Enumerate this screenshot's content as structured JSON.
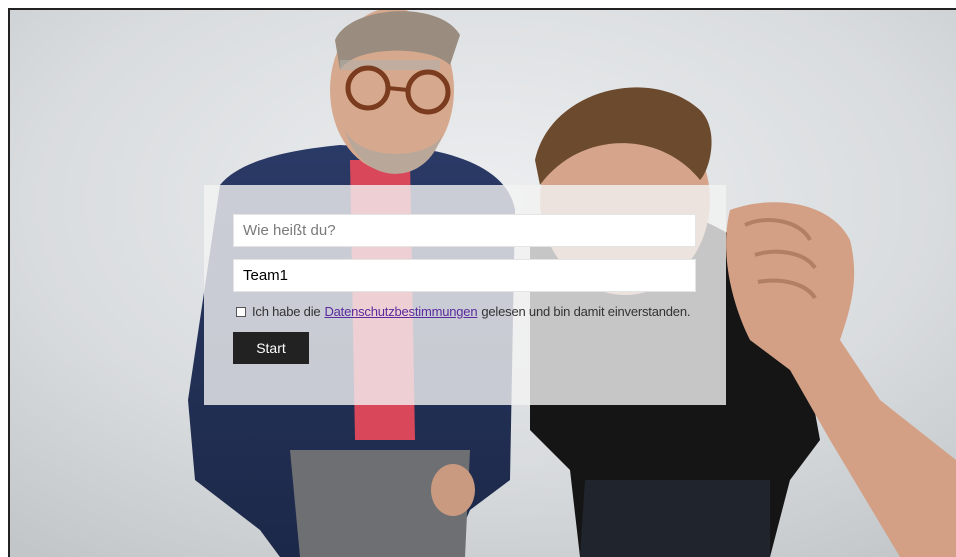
{
  "form": {
    "name_placeholder": "Wie heißt du?",
    "name_value": "",
    "team_value": "Team1",
    "consent_before": "Ich habe die",
    "consent_link": "Datenschutzbestimmungen",
    "consent_after": "gelesen und bin damit einverstanden.",
    "consent_checked": false,
    "start_label": "Start"
  },
  "colors": {
    "button_bg": "#222222",
    "link": "#5b2a9c",
    "overlay": "#f2f2f2"
  },
  "background": {
    "subject": "two-men-photo"
  }
}
